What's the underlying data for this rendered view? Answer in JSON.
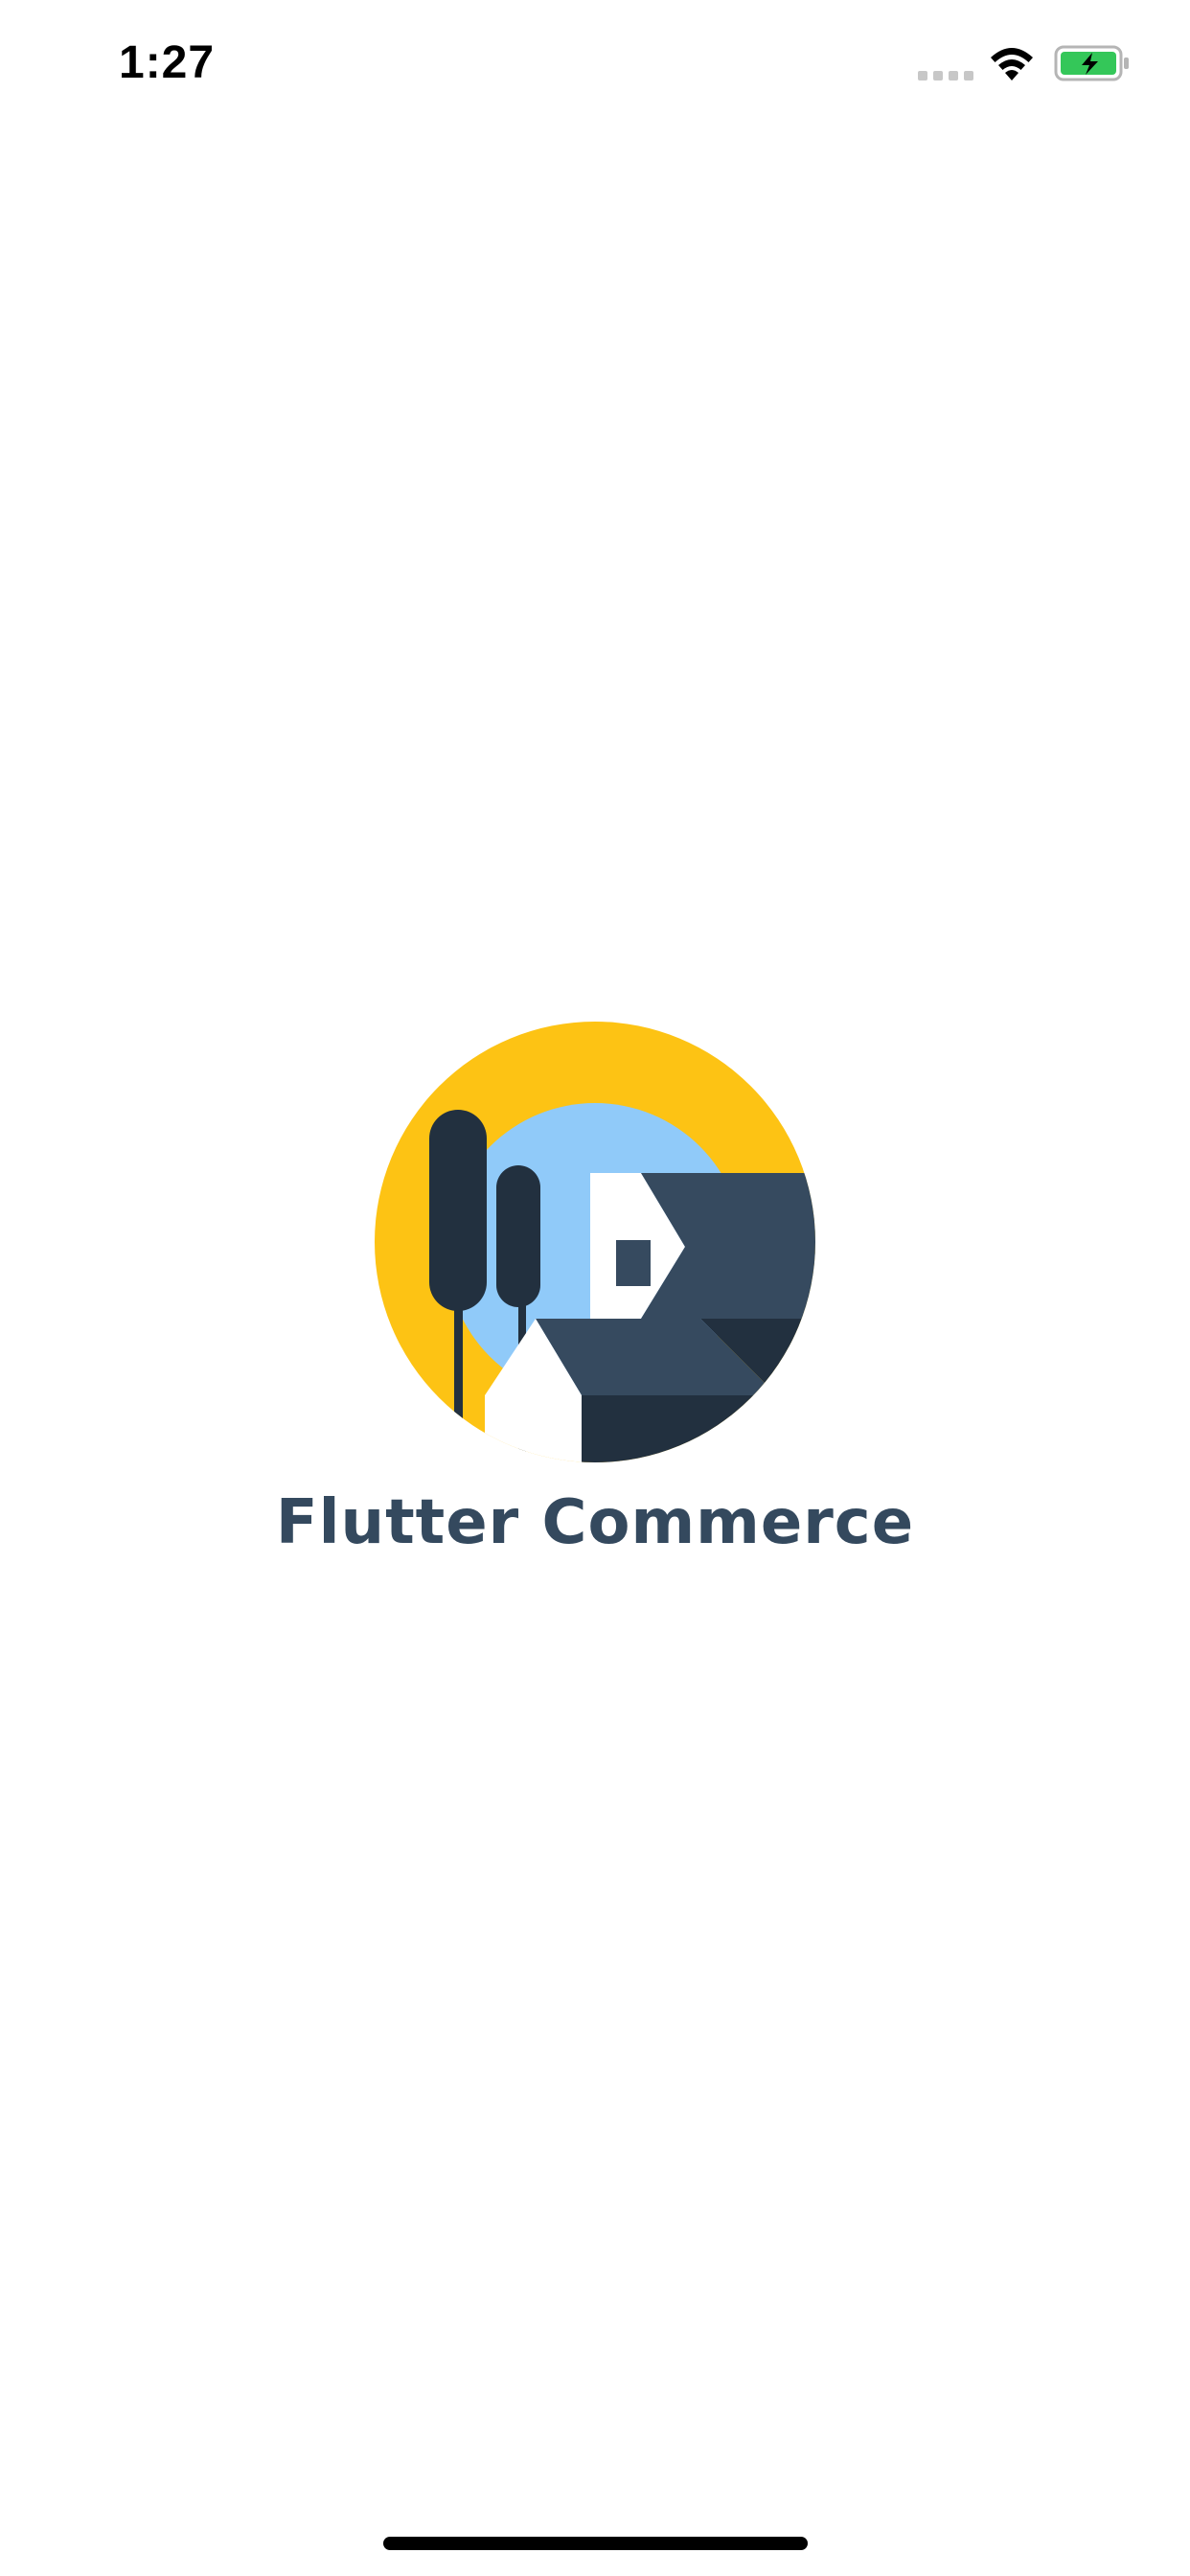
{
  "status_bar": {
    "time": "1:27",
    "icons": [
      "cellular-signal-icon",
      "wifi-icon",
      "battery-charging-icon"
    ],
    "battery_color": "#34c759"
  },
  "splash": {
    "title": "Flutter Commerce",
    "logo": "house-trees-sun-logo",
    "colors": {
      "title": "#34495e",
      "sun": "#fdc314",
      "sky": "#90caf9",
      "roof": "#364a5f",
      "dark": "#22303f",
      "wall": "#ffffff"
    }
  }
}
